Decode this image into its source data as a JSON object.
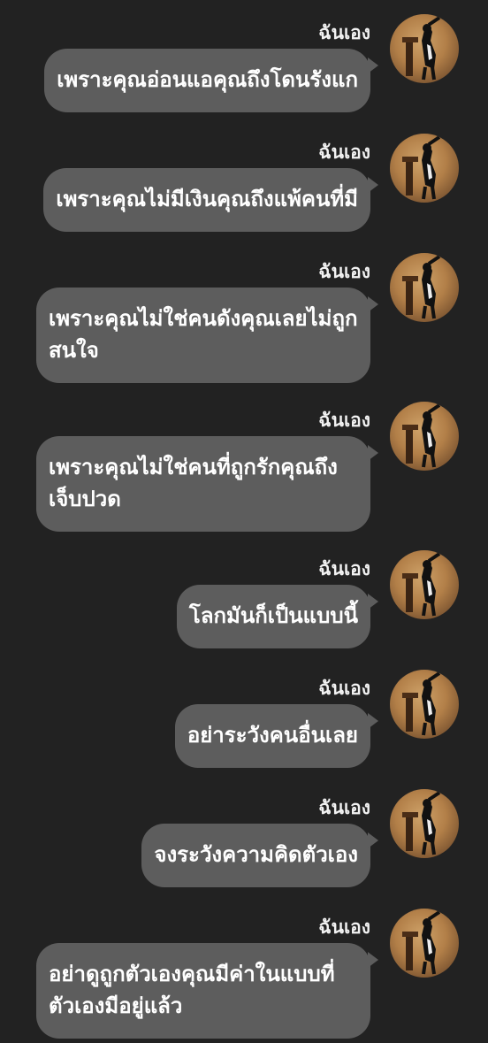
{
  "messages": [
    {
      "sender": "ฉันเอง",
      "text": "เพราะคุณอ่อนแอคุณถึงโดนรังแก",
      "avatar_icon": "cat-dancing-avatar-icon"
    },
    {
      "sender": "ฉันเอง",
      "text": "เพราะคุณไม่มีเงินคุณถึงแพ้คนที่มี",
      "avatar_icon": "cat-dancing-avatar-icon"
    },
    {
      "sender": "ฉันเอง",
      "text": "เพราะคุณไม่ใช่คนดังคุณเลยไม่ถูกสนใจ",
      "avatar_icon": "cat-dancing-avatar-icon"
    },
    {
      "sender": "ฉันเอง",
      "text": "เพราะคุณไม่ใช่คนที่ถูกรักคุณถึงเจ็บปวด",
      "avatar_icon": "cat-dancing-avatar-icon"
    },
    {
      "sender": "ฉันเอง",
      "text": "โลกมันก็เป็นแบบนี้",
      "avatar_icon": "cat-dancing-avatar-icon"
    },
    {
      "sender": "ฉันเอง",
      "text": "อย่าระวังคนอื่นเลย",
      "avatar_icon": "cat-dancing-avatar-icon"
    },
    {
      "sender": "ฉันเอง",
      "text": "จงระวังความคิดตัวเอง",
      "avatar_icon": "cat-dancing-avatar-icon"
    },
    {
      "sender": "ฉันเอง",
      "text": "อย่าดูถูกตัวเองคุณมีค่าในแบบที่ตัวเองมีอยู่แล้ว",
      "avatar_icon": "cat-dancing-avatar-icon"
    }
  ],
  "colors": {
    "background": "#222222",
    "bubble": "#5d5d5d",
    "text": "#ffffff"
  }
}
